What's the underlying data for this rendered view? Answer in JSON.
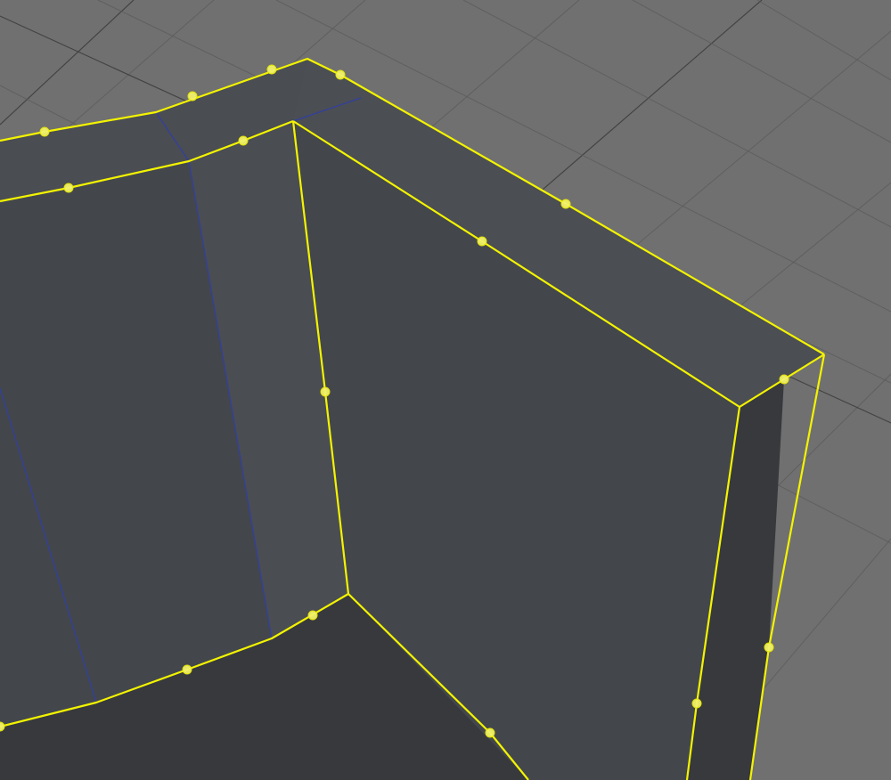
{
  "viewport": {
    "grid": "on",
    "selection_color": "#f3f300",
    "inner_edge_color": "#2f3ea8",
    "background_color": "#707070"
  }
}
